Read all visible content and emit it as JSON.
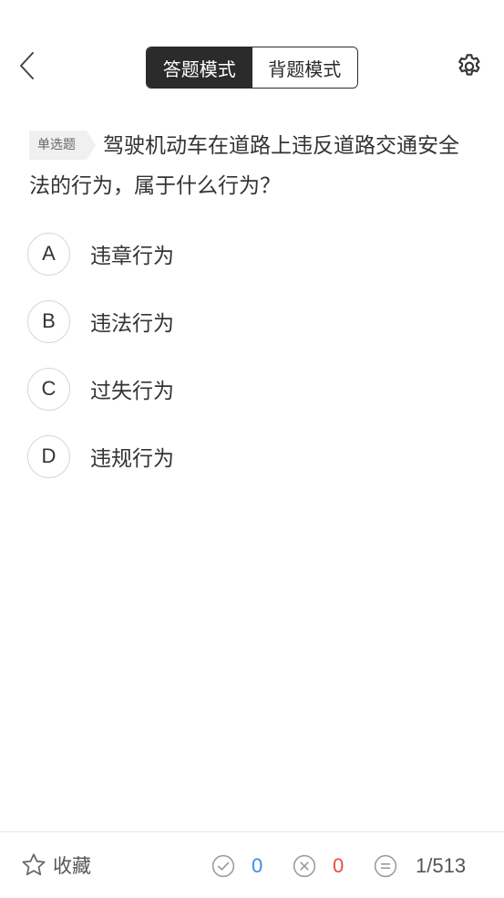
{
  "header": {
    "modes": [
      {
        "label": "答题模式",
        "active": true
      },
      {
        "label": "背题模式",
        "active": false
      }
    ]
  },
  "question": {
    "type": "单选题",
    "text": "驾驶机动车在道路上违反道路交通安全法的行为，属于什么行为？"
  },
  "options": [
    {
      "letter": "A",
      "text": "违章行为"
    },
    {
      "letter": "B",
      "text": "违法行为"
    },
    {
      "letter": "C",
      "text": "过失行为"
    },
    {
      "letter": "D",
      "text": "违规行为"
    }
  ],
  "footer": {
    "favorite_label": "收藏",
    "correct_count": "0",
    "wrong_count": "0",
    "progress": "1/513"
  },
  "colors": {
    "accent_dark": "#2b2b2b",
    "correct": "#3a8ee6",
    "wrong": "#e84c3d"
  },
  "icons": {
    "back": "chevron-left-icon",
    "settings": "gear-icon",
    "favorite": "star-icon",
    "correct": "check-circle-icon",
    "wrong": "x-circle-icon",
    "progress": "list-circle-icon"
  }
}
